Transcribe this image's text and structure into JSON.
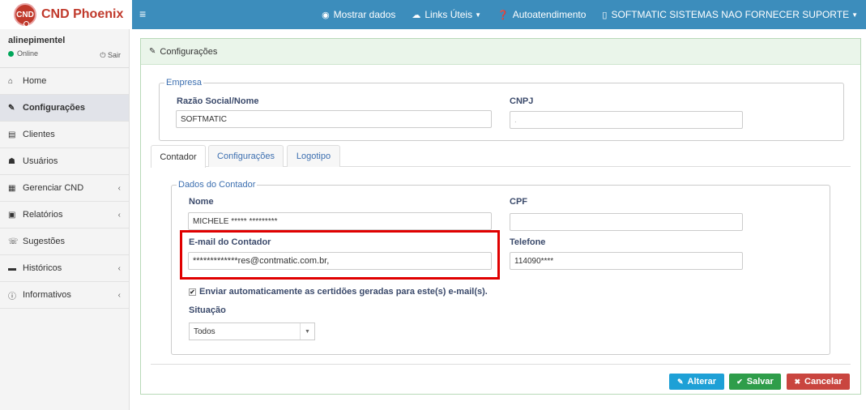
{
  "app": {
    "logo_badge": "CND",
    "logo_text": "CND Phoenix"
  },
  "topbar": {
    "menu_icon": "≡",
    "items": [
      {
        "label": "Mostrar dados",
        "icon": "eye-icon"
      },
      {
        "label": "Links Úteis",
        "icon": "cloud-icon"
      },
      {
        "label": "Autoatendimento",
        "icon": "help-icon"
      },
      {
        "label": "SOFTMATIC SISTEMAS NAO FORNECER SUPORTE",
        "icon": "building-icon"
      }
    ]
  },
  "user": {
    "name": "alinepimentel",
    "status": "Online",
    "logout": "Sair"
  },
  "sidebar": {
    "items": [
      {
        "label": "Home"
      },
      {
        "label": "Configurações"
      },
      {
        "label": "Clientes"
      },
      {
        "label": "Usuários"
      },
      {
        "label": "Gerenciar CND"
      },
      {
        "label": "Relatórios"
      },
      {
        "label": "Sugestões"
      },
      {
        "label": "Históricos"
      },
      {
        "label": "Informativos"
      }
    ]
  },
  "panel": {
    "title": "Configurações",
    "empresa": {
      "legend": "Empresa",
      "razao_label": "Razão Social/Nome",
      "razao_value": "SOFTMATIC",
      "cnpj_label": "CNPJ",
      "cnpj_value": "."
    },
    "tabs": [
      "Contador",
      "Configurações",
      "Logotipo"
    ],
    "contador": {
      "legend": "Dados do Contador",
      "nome_label": "Nome",
      "nome_value": "MICHELE ***** *********",
      "cpf_label": "CPF",
      "cpf_value": "",
      "email_label": "E-mail do Contador",
      "email_value": "*************res@contmatic.com.br,",
      "telefone_label": "Telefone",
      "telefone_value": "114090****",
      "checkbox_label": "Enviar automaticamente as certidões geradas para este(s) e-mail(s).",
      "situacao_label": "Situação",
      "situacao_value": "Todos"
    },
    "buttons": {
      "alterar": "Alterar",
      "salvar": "Salvar",
      "cancelar": "Cancelar"
    }
  },
  "colors": {
    "topbar": "#3c8dbc",
    "alterar": "#1ea0d6",
    "salvar": "#2e9d4a",
    "cancelar": "#c9453f",
    "highlight": "#e00000"
  }
}
